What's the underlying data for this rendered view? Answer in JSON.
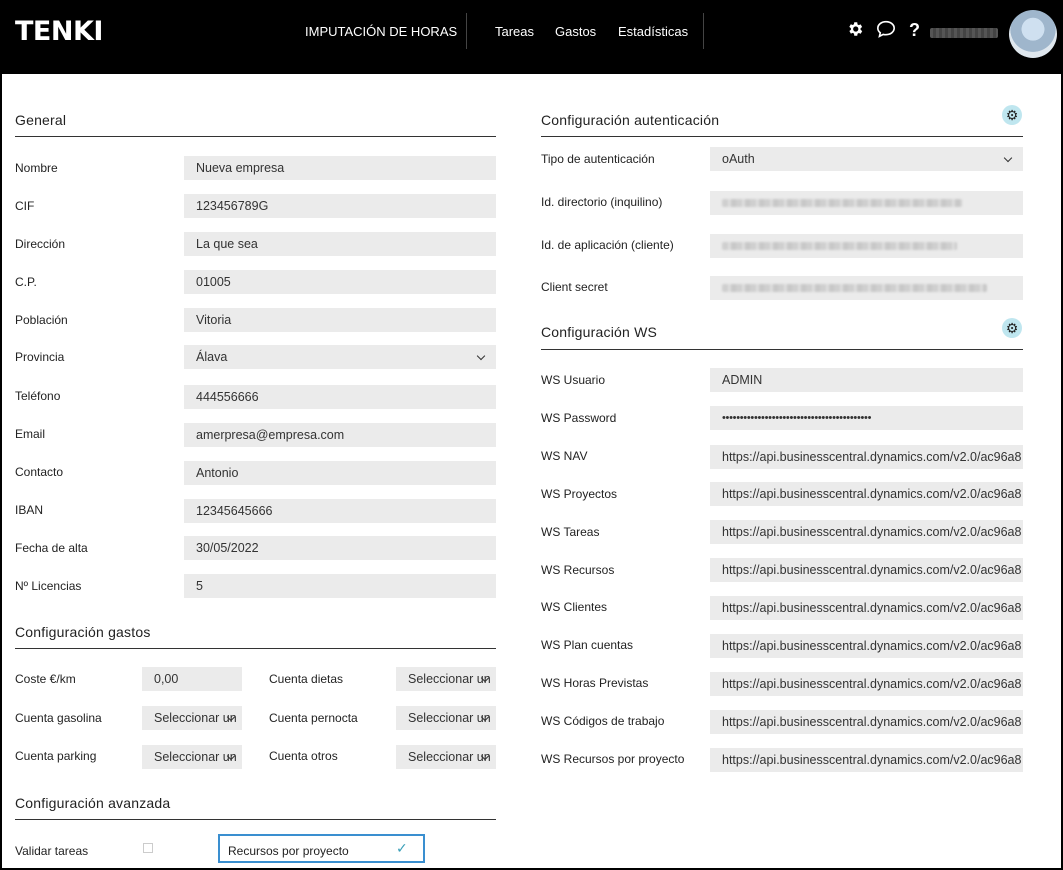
{
  "app": {
    "logo": "TENKI",
    "nav": {
      "imputacion": "IMPUTACIÓN DE HORAS",
      "tareas": "Tareas",
      "gastos": "Gastos",
      "estadisticas": "Estadísticas"
    },
    "icons": {
      "settings": "gear-icon",
      "chat": "chat-icon",
      "help": "help-icon"
    }
  },
  "general": {
    "title": "General",
    "fields": [
      {
        "label": "Nombre",
        "value": "Nueva empresa"
      },
      {
        "label": "CIF",
        "value": "123456789G"
      },
      {
        "label": "Dirección",
        "value": "La que sea"
      },
      {
        "label": "C.P.",
        "value": "01005"
      },
      {
        "label": "Población",
        "value": "Vitoria"
      },
      {
        "label": "Provincia",
        "value": "Álava"
      },
      {
        "label": "Teléfono",
        "value": "444556666"
      },
      {
        "label": "Email",
        "value": "amerpresa@empresa.com"
      },
      {
        "label": "Contacto",
        "value": "Antonio"
      },
      {
        "label": "IBAN",
        "value": "12345645666"
      },
      {
        "label": "Fecha de alta",
        "value": "30/05/2022"
      },
      {
        "label": "Nº Licencias",
        "value": "5"
      }
    ]
  },
  "gastos": {
    "title": "Configuración gastos",
    "coste_km": {
      "label": "Coste €/km",
      "value": "0,00"
    },
    "cuenta_gasolina": {
      "label": "Cuenta gasolina",
      "value": "Seleccionar un"
    },
    "cuenta_parking": {
      "label": "Cuenta parking",
      "value": "Seleccionar un"
    },
    "cuenta_dietas": {
      "label": "Cuenta dietas",
      "value": "Seleccionar un"
    },
    "cuenta_pernocta": {
      "label": "Cuenta pernocta",
      "value": "Seleccionar un"
    },
    "cuenta_otros": {
      "label": "Cuenta otros",
      "value": "Seleccionar un"
    }
  },
  "avanzada": {
    "title": "Configuración avanzada",
    "validar_tareas": {
      "label": "Validar tareas",
      "checked": false
    },
    "recursos_por_proyecto": {
      "label": "Recursos por proyecto",
      "checked": true
    }
  },
  "autenticacion": {
    "title": "Configuración autenticación",
    "tipo": {
      "label": "Tipo de autenticación",
      "value": "oAuth"
    },
    "directorio": {
      "label": "Id. directorio (inquilino)"
    },
    "aplicacion": {
      "label": "Id. de aplicación (cliente)"
    },
    "secret": {
      "label": "Client secret"
    }
  },
  "ws": {
    "title": "Configuración WS",
    "usuario": {
      "label": "WS Usuario",
      "value": "ADMIN"
    },
    "password": {
      "label": "WS Password",
      "value": "••••••••••••••••••••••••••••••••••••••••••"
    },
    "urls": [
      {
        "label": "WS NAV",
        "value": "https://api.businesscentral.dynamics.com/v2.0/ac96a8"
      },
      {
        "label": "WS Proyectos",
        "value": "https://api.businesscentral.dynamics.com/v2.0/ac96a8"
      },
      {
        "label": "WS Tareas",
        "value": "https://api.businesscentral.dynamics.com/v2.0/ac96a8"
      },
      {
        "label": "WS Recursos",
        "value": "https://api.businesscentral.dynamics.com/v2.0/ac96a8"
      },
      {
        "label": "WS Clientes",
        "value": "https://api.businesscentral.dynamics.com/v2.0/ac96a8"
      },
      {
        "label": "WS Plan cuentas",
        "value": "https://api.businesscentral.dynamics.com/v2.0/ac96a8"
      },
      {
        "label": "WS Horas Previstas",
        "value": "https://api.businesscentral.dynamics.com/v2.0/ac96a8"
      },
      {
        "label": "WS Códigos de trabajo",
        "value": "https://api.businesscentral.dynamics.com/v2.0/ac96a8"
      },
      {
        "label": "WS Recursos por proyecto",
        "value": "https://api.businesscentral.dynamics.com/v2.0/ac96a8"
      }
    ]
  }
}
